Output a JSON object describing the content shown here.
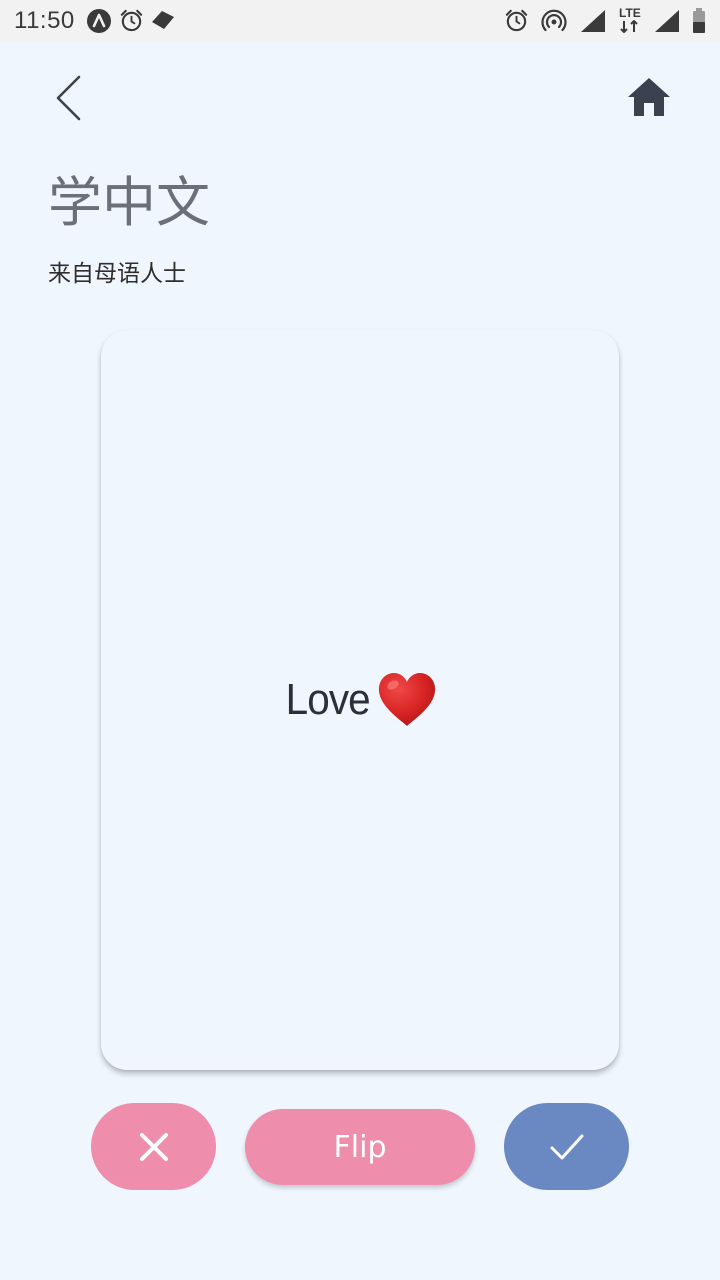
{
  "status_bar": {
    "time": "11:50",
    "network_label": "LTE"
  },
  "header": {
    "title": "学中文",
    "subtitle": "来自母语人士"
  },
  "card": {
    "word": "Love",
    "emoji": "heart-icon"
  },
  "buttons": {
    "wrong_icon": "close-icon",
    "flip_label": "Flip",
    "right_icon": "check-icon"
  },
  "colors": {
    "background": "#EFF6FE",
    "status_bar": "#F2F2F2",
    "pink": "#EE8DAC",
    "blue": "#6A88C2",
    "title": "#6A6F7A",
    "icon_dark": "#3C4150",
    "heart": "#D62323"
  }
}
